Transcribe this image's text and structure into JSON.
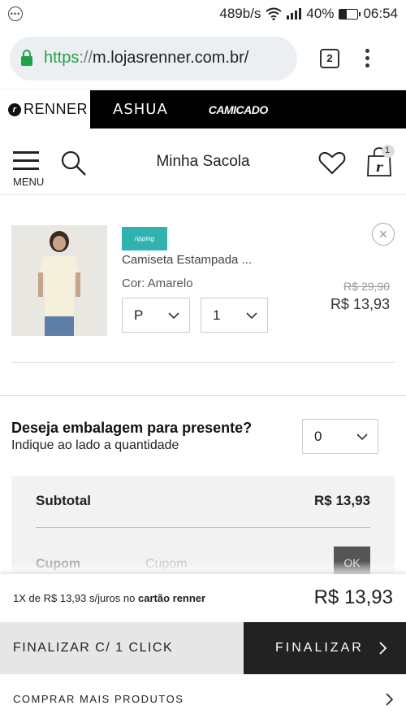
{
  "status_bar": {
    "net_speed": "489b/s",
    "battery": "40%",
    "battery_level": 0.4,
    "time": "06:54"
  },
  "browser": {
    "url_scheme": "https",
    "url_sep": "://",
    "url_host": "m.lojasrenner.com.br/",
    "tab_count": "2"
  },
  "brands": {
    "renner": "RENNER",
    "ashua": "ASHUA",
    "camicado": "CAMICADO"
  },
  "header": {
    "menu_label": "MENU",
    "title": "Minha Sacola",
    "bag_count": "1"
  },
  "cart_item": {
    "brand_badge": "ripping",
    "name": "Camiseta Estampada ...",
    "color": "Cor: Amarelo",
    "size": "P",
    "quantity": "1",
    "old_price": "R$ 29,90",
    "price": "R$ 13,93"
  },
  "gift": {
    "title": "Deseja embalagem para presente?",
    "subtitle": "Indique ao lado a quantidade",
    "quantity": "0"
  },
  "summary": {
    "subtotal_label": "Subtotal",
    "subtotal_value": "R$ 13,93",
    "coupon_label": "Cupom",
    "coupon_placeholder": "Cupom",
    "ok_label": "OK"
  },
  "checkout": {
    "installment_prefix": "1X de",
    "installment_value": "R$ 13,93",
    "installment_suffix": "s/juros no",
    "installment_card": "cartão renner",
    "total": "R$ 13,93",
    "one_click_label": "FINALIZAR C/ 1 CLICK",
    "finalize_label": "FINALIZAR",
    "more_products_label": "COMPRAR MAIS PRODUTOS"
  },
  "colors": {
    "lock_green": "#1ea446",
    "brand_badge": "#30b3b0",
    "finalize_bg": "#222222"
  }
}
